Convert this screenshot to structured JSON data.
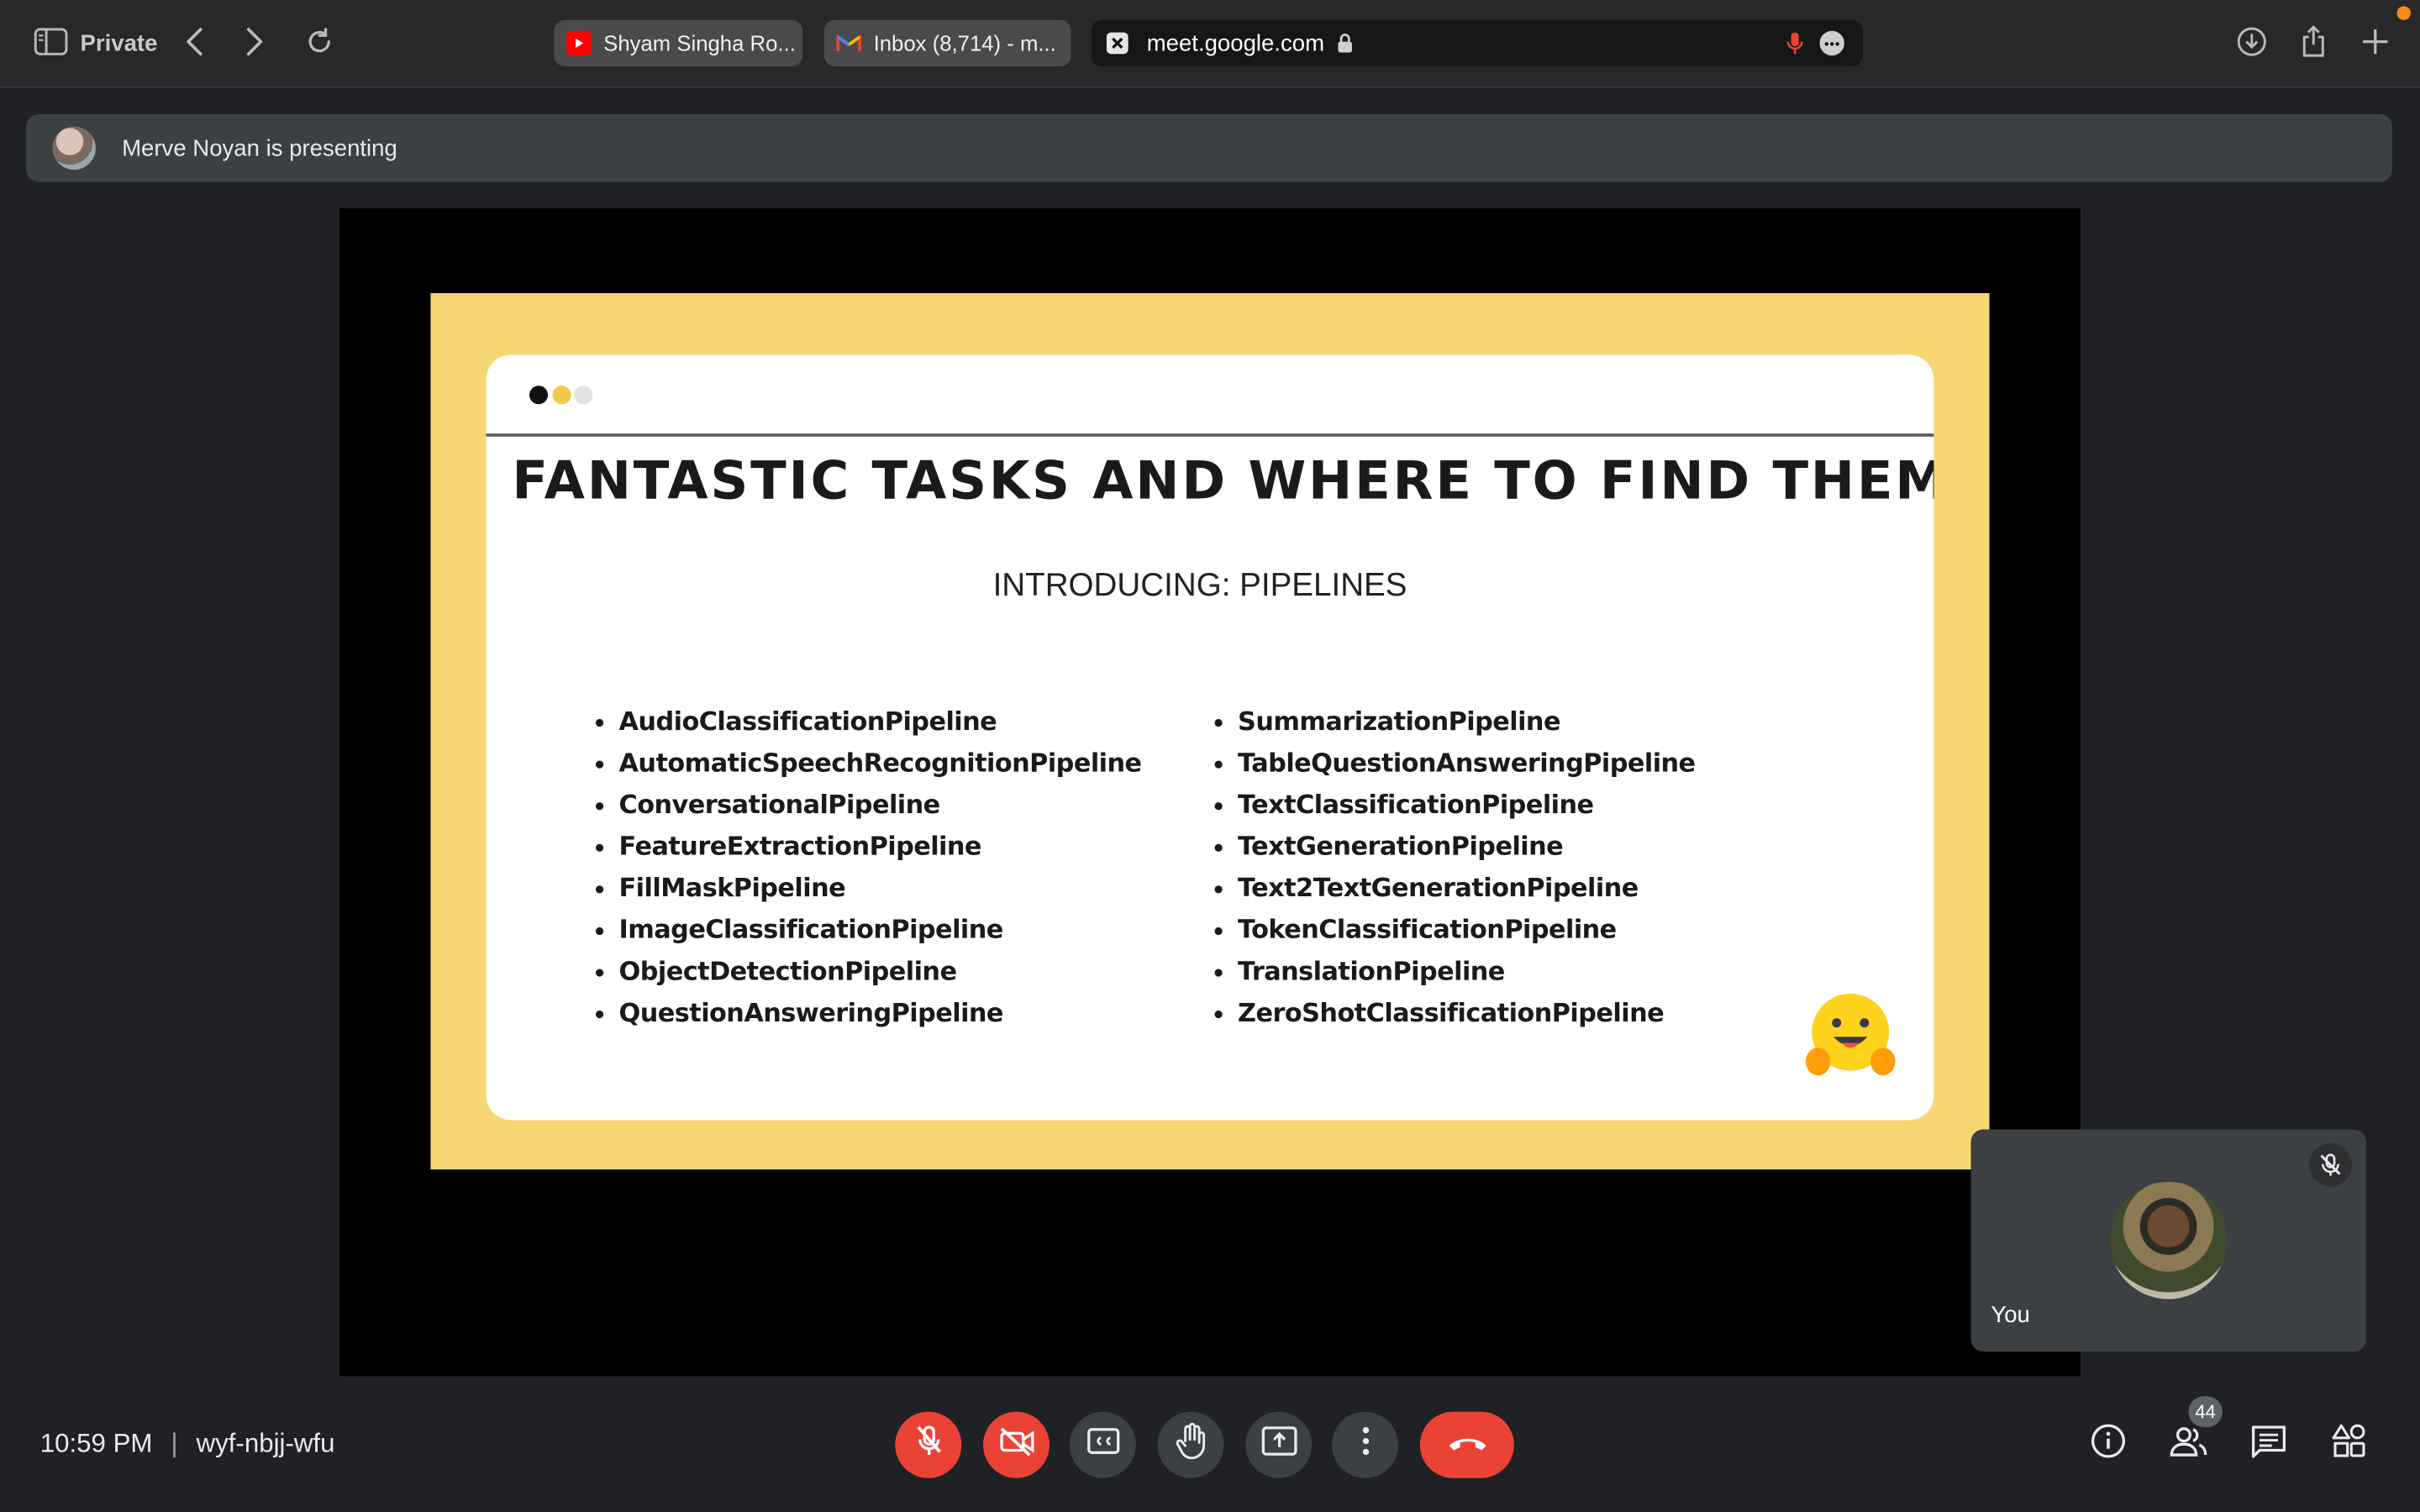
{
  "browser": {
    "private_label": "Private",
    "tabs": [
      {
        "title": "Shyam Singha Ro...",
        "favicon": "youtube-icon",
        "favicon_color": "#ff0000"
      },
      {
        "title": "Inbox (8,714) - m...",
        "favicon": "gmail-icon",
        "favicon_color": "#ea4335"
      }
    ],
    "address": "meet.google.com"
  },
  "meet": {
    "presenting_text": "Merve Noyan is presenting",
    "slide": {
      "title": "FANTASTIC TASKS AND WHERE TO FIND THEM",
      "subtitle": "INTRODUCING: PIPELINES",
      "left_items": [
        "AudioClassificationPipeline",
        "AutomaticSpeechRecognitionPipeline",
        "ConversationalPipeline",
        "FeatureExtractionPipeline",
        "FillMaskPipeline",
        "ImageClassificationPipeline",
        "ObjectDetectionPipeline",
        "QuestionAnsweringPipeline"
      ],
      "right_items": [
        "SummarizationPipeline",
        "TableQuestionAnsweringPipeline",
        "TextClassificationPipeline",
        "TextGenerationPipeline",
        "Text2TextGenerationPipeline",
        "TokenClassificationPipeline",
        "TranslationPipeline",
        "ZeroShotClassificationPipeline"
      ],
      "accent_color": "#f7d774"
    },
    "self_tile": {
      "name": "You"
    },
    "footer": {
      "time": "10:59 PM",
      "separator": "|",
      "meeting_code": "wyf-nbjj-wfu",
      "participants_count": "44"
    },
    "colors": {
      "leave": "#ea4335",
      "muted": "#ea4335",
      "control_bg": "#3c4043"
    }
  }
}
